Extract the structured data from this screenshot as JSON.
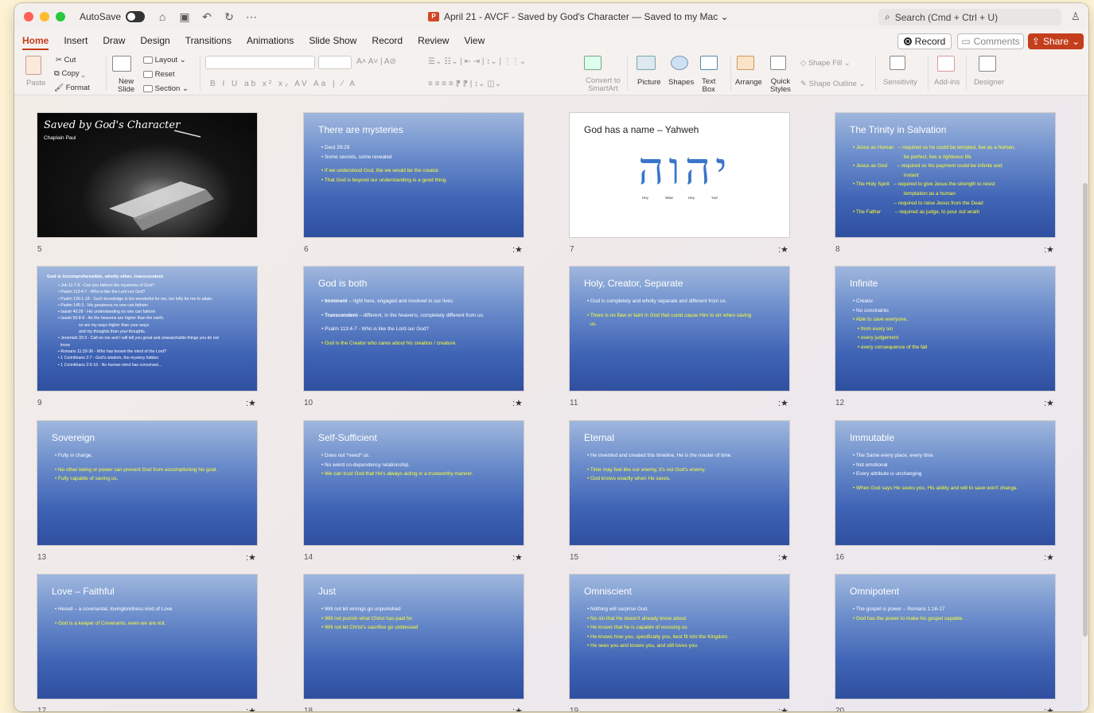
{
  "titlebar": {
    "autosave_label": "AutoSave",
    "doc_title": "April 21 - AVCF - Saved by God's Character — Saved to my Mac ⌄",
    "search_placeholder": "Search (Cmd + Ctrl + U)"
  },
  "menu": {
    "tabs": [
      "Home",
      "Insert",
      "Draw",
      "Design",
      "Transitions",
      "Animations",
      "Slide Show",
      "Record",
      "Review",
      "View"
    ],
    "active_tab": "Home",
    "record_label": "Record",
    "comments_label": "Comments",
    "share_label": "Share"
  },
  "ribbon": {
    "paste": "Paste",
    "cut": "Cut",
    "copy": "Copy",
    "format": "Format",
    "new_slide_1": "New",
    "new_slide_2": "Slide",
    "layout": "Layout",
    "reset": "Reset",
    "section": "Section",
    "convert_1": "Convert to",
    "convert_2": "SmartArt",
    "picture": "Picture",
    "shapes": "Shapes",
    "textbox_1": "Text",
    "textbox_2": "Box",
    "arrange": "Arrange",
    "quick_1": "Quick",
    "quick_2": "Styles",
    "shape_fill": "Shape Fill",
    "shape_outline": "Shape Outline",
    "sensitivity": "Sensitivity",
    "addins": "Add-ins",
    "designer": "Designer"
  },
  "slides": [
    {
      "num": "5",
      "title": "Saved by God's Character",
      "subtitle": "Chaplain Paul",
      "lines": []
    },
    {
      "num": "6",
      "title": "There are mysteries",
      "lines": [
        {
          "t": "• Deut 29:29",
          "c": "w"
        },
        {
          "t": "• Some secrets, some revealed",
          "c": "w"
        },
        {
          "t": "",
          "c": "w"
        },
        {
          "t": "• If we understood God, the we would be the creator.",
          "c": "y"
        },
        {
          "t": "• That God is beyond our understanding is a good thing.",
          "c": "y"
        }
      ]
    },
    {
      "num": "7",
      "title": "God has a name – Yahweh",
      "hebrew": "יהוה",
      "letters": [
        "Hey",
        "Waw",
        "Hey",
        "Yod"
      ],
      "lines": []
    },
    {
      "num": "8",
      "title": "The Trinity in Salvation",
      "lines": [
        {
          "t": "• Jesus as Human   – required so he could be tempted, live as a human,",
          "c": "y"
        },
        {
          "t": "                                    be perfect, live a righteous life",
          "c": "y"
        },
        {
          "t": "• Jesus as God       – required so his payment could be infinite and",
          "c": "y"
        },
        {
          "t": "                                    instant",
          "c": "y"
        },
        {
          "t": "• The Holy Spirit   – required to give Jesus the strength to resist",
          "c": "y"
        },
        {
          "t": "                                    temptation as a human",
          "c": "y"
        },
        {
          "t": "                             – required to raise Jesus from the Dead",
          "c": "y"
        },
        {
          "t": "• The Father          – required as judge, to pour out wrath",
          "c": "y"
        }
      ]
    },
    {
      "num": "9",
      "title": "God is incomprehensible, wholly other, transcendent",
      "lines": [
        {
          "t": "• Job 11:7-9 - Can you fathom the mysteries of God?",
          "c": "w"
        },
        {
          "t": "• Psalm 113:4-7 - Who is like the Lord our God?",
          "c": "w"
        },
        {
          "t": "• Psalm 139:1-18 - Such knowledge is too wonderful for me, too lofty for me to attain.",
          "c": "w"
        },
        {
          "t": "• Psalm 145:3 - His greatness no one can fathom",
          "c": "w"
        },
        {
          "t": "• Isaiah 40:28 - His understanding no one can fathom",
          "c": "w"
        },
        {
          "t": "• Isaiah 55:8-9 - As the heavens are higher than the earth,",
          "c": "w"
        },
        {
          "t": "so are my ways higher than your ways",
          "c": "w",
          "ind": 2
        },
        {
          "t": "and my thoughts than your thoughts.",
          "c": "w",
          "ind": 2
        },
        {
          "t": "• Jeremiah 33:3 - Call on me and I will tell you great and unsearchable things you do not",
          "c": "w"
        },
        {
          "t": "  know",
          "c": "w"
        },
        {
          "t": "• Romans 11:33-36 - Who has known the mind of the Lord?",
          "c": "w"
        },
        {
          "t": "• 1 Corinthians 2:7 - God's wisdom, the mystery hidden",
          "c": "w"
        },
        {
          "t": "• 1 Corinthians 2:9-16 - No human mind has conceived...",
          "c": "w"
        }
      ]
    },
    {
      "num": "10",
      "title": "God is both",
      "lines": [
        {
          "t": "• Imminent – right here, engaged and involved in our lives",
          "c": "w",
          "b": "Imminent"
        },
        {
          "t": "",
          "c": "w"
        },
        {
          "t": "• Transcendent – different, in the heavens, completely different from us.",
          "c": "w",
          "b": "Transcendent"
        },
        {
          "t": "",
          "c": "w"
        },
        {
          "t": "• Psalm 113:4-7 - Who is like the Lord our God?",
          "c": "w"
        },
        {
          "t": "",
          "c": "w"
        },
        {
          "t": "• God is the Creator who cares about his creation / creature.",
          "c": "y"
        }
      ]
    },
    {
      "num": "11",
      "title": "Holy, Creator, Separate",
      "lines": [
        {
          "t": "• God is completely and wholly separate and different from us.",
          "c": "w"
        },
        {
          "t": "",
          "c": "w"
        },
        {
          "t": "• There is no flaw or taint in God that could cause Him to err when saving",
          "c": "y"
        },
        {
          "t": "  us.",
          "c": "y"
        }
      ]
    },
    {
      "num": "12",
      "title": "Infinite",
      "lines": [
        {
          "t": "• Creator",
          "c": "w"
        },
        {
          "t": "• No constraints",
          "c": "w"
        },
        {
          "t": "• Able to save everyone,",
          "c": "y"
        },
        {
          "t": "• from every sin",
          "c": "y",
          "ind": 1
        },
        {
          "t": "• every judgement",
          "c": "y",
          "ind": 1
        },
        {
          "t": "• every consequence of the fall",
          "c": "y",
          "ind": 1
        }
      ]
    },
    {
      "num": "13",
      "title": "Sovereign",
      "lines": [
        {
          "t": "• Fully in charge,",
          "c": "w"
        },
        {
          "t": "",
          "c": "w"
        },
        {
          "t": "• No other being or power can prevent God from accomplishing his goal.",
          "c": "y"
        },
        {
          "t": "• Fully capable of saving us.",
          "c": "y"
        }
      ]
    },
    {
      "num": "14",
      "title": "Self-Sufficient",
      "lines": [
        {
          "t": "• Does not *need* us.",
          "c": "w"
        },
        {
          "t": "• No weird co-dependency relationship.",
          "c": "w"
        },
        {
          "t": "• We can trust God that He's always acting in a trustworthy manner.",
          "c": "y"
        }
      ]
    },
    {
      "num": "15",
      "title": "Eternal",
      "lines": [
        {
          "t": "• He invented and created this timeline, He is the master of time.",
          "c": "w"
        },
        {
          "t": "",
          "c": "w"
        },
        {
          "t": "• Time may feel like our enemy, it's not God's enemy.",
          "c": "y"
        },
        {
          "t": "• God knows exactly when He saves.",
          "c": "y"
        }
      ]
    },
    {
      "num": "16",
      "title": "Immutable",
      "lines": [
        {
          "t": "• The Same every place, every time",
          "c": "w"
        },
        {
          "t": "• Not emotional",
          "c": "w"
        },
        {
          "t": "• Every attribute is unchanging",
          "c": "w"
        },
        {
          "t": "",
          "c": "w"
        },
        {
          "t": "• When God says He saves you, His ability and will to save won't change.",
          "c": "y"
        }
      ]
    },
    {
      "num": "17",
      "title": "Love – Faithful",
      "lines": [
        {
          "t": "• Hesed – a covenantal, lovingkindness kind of Love",
          "c": "w"
        },
        {
          "t": "",
          "c": "w"
        },
        {
          "t": "• God is a keeper of Covenants, even we are not.",
          "c": "y"
        }
      ]
    },
    {
      "num": "18",
      "title": "Just",
      "lines": [
        {
          "t": "• Will not let wrongs go unpunished",
          "c": "w"
        },
        {
          "t": "• Will not punish what Christ has paid for",
          "c": "y"
        },
        {
          "t": "• Will not let Christ's sacrifice go unblessed",
          "c": "y"
        }
      ]
    },
    {
      "num": "19",
      "title": "Omniscient",
      "lines": [
        {
          "t": "• Nothing will surprise God.",
          "c": "w"
        },
        {
          "t": "• No sin that He doesn't already know about.",
          "c": "y"
        },
        {
          "t": "• He knows that he is capable of rescuing us.",
          "c": "y"
        },
        {
          "t": "• He knows how you, specifically you, best fit into the Kingdom.",
          "c": "y"
        },
        {
          "t": "• He sees you and knows you, and still loves you.",
          "c": "y"
        }
      ]
    },
    {
      "num": "20",
      "title": "Omnipotent",
      "lines": [
        {
          "t": "• The gospel is power – Romans 1:16-17",
          "c": "w"
        },
        {
          "t": "• God has the power to make his gospel capable.",
          "c": "y"
        }
      ]
    }
  ],
  "star_glyph": ":★"
}
